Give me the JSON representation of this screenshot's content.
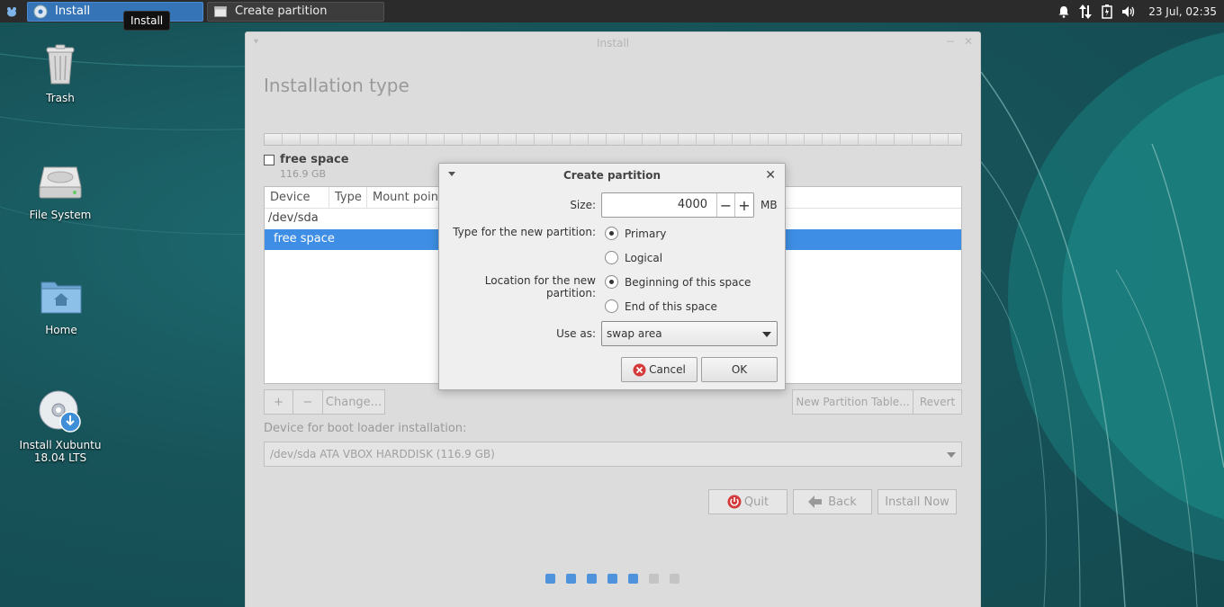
{
  "panel": {
    "tasks": [
      {
        "label": "Install"
      },
      {
        "label": "Create partition"
      }
    ],
    "tooltip": "Install",
    "clock": "23 Jul, 02:35"
  },
  "desktop": {
    "icons": [
      {
        "label": "Trash"
      },
      {
        "label": "File System"
      },
      {
        "label": "Home"
      },
      {
        "label": "Install Xubuntu 18.04 LTS"
      }
    ]
  },
  "installer": {
    "title": "Install",
    "page_title": "Installation type",
    "legend": {
      "label": "free space",
      "size": "116.9 GB"
    },
    "table": {
      "columns": [
        "Device",
        "Type",
        "Mount point"
      ],
      "rows": [
        {
          "device": "/dev/sda"
        },
        {
          "device": "free space"
        }
      ]
    },
    "buttons": {
      "add": "+",
      "remove": "−",
      "change": "Change...",
      "new_table": "New Partition Table...",
      "revert": "Revert"
    },
    "boot_label": "Device for boot loader installation:",
    "boot_device": "/dev/sda ATA VBOX HARDDISK (116.9 GB)",
    "nav": {
      "quit": "Quit",
      "back": "Back",
      "install_now": "Install Now"
    },
    "progress": {
      "total": 7,
      "done": 5
    }
  },
  "dialog": {
    "title": "Create partition",
    "size_label": "Size:",
    "size_value": "4000",
    "size_unit": "MB",
    "type_label": "Type for the new partition:",
    "type_options": [
      "Primary",
      "Logical"
    ],
    "type_selected": "Primary",
    "location_label": "Location for the new partition:",
    "location_options": [
      "Beginning of this space",
      "End of this space"
    ],
    "location_selected": "Beginning of this space",
    "use_label": "Use as:",
    "use_value": "swap area",
    "cancel": "Cancel",
    "ok": "OK"
  },
  "colors": {
    "accent": "#3d8ee4",
    "panel": "#2b2b2b",
    "desktop": "#17545a"
  }
}
